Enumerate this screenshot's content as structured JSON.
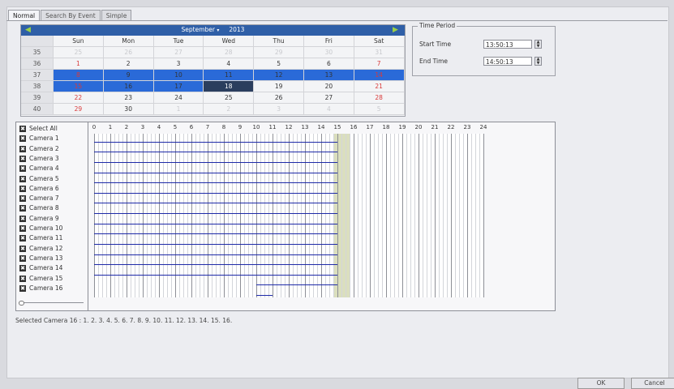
{
  "tabs": [
    "Normal",
    "Search By Event",
    "Simple"
  ],
  "calendar": {
    "month": "September",
    "year": "2013",
    "days": [
      "Sun",
      "Mon",
      "Tue",
      "Wed",
      "Thu",
      "Fri",
      "Sat"
    ],
    "weeks": [
      {
        "wk": "35",
        "cells": [
          "25",
          "26",
          "27",
          "28",
          "29",
          "30",
          "31"
        ]
      },
      {
        "wk": "36",
        "cells": [
          "1",
          "2",
          "3",
          "4",
          "5",
          "6",
          "7"
        ]
      },
      {
        "wk": "37",
        "cells": [
          "8",
          "9",
          "10",
          "11",
          "12",
          "13",
          "14"
        ]
      },
      {
        "wk": "38",
        "cells": [
          "15",
          "16",
          "17",
          "18",
          "19",
          "20",
          "21"
        ]
      },
      {
        "wk": "39",
        "cells": [
          "22",
          "23",
          "24",
          "25",
          "26",
          "27",
          "28"
        ]
      },
      {
        "wk": "40",
        "cells": [
          "29",
          "30",
          "1",
          "2",
          "3",
          "4",
          "5"
        ]
      }
    ]
  },
  "time_period": {
    "legend": "Time Period",
    "start_label": "Start Time",
    "start_value": "13:50:13",
    "end_label": "End Time",
    "end_value": "14:50:13"
  },
  "cameras": {
    "select_all": "Select All",
    "items": [
      "Camera 1",
      "Camera 2",
      "Camera 3",
      "Camera 4",
      "Camera 5",
      "Camera 6",
      "Camera 7",
      "Camera 8",
      "Camera 9",
      "Camera 10",
      "Camera 11",
      "Camera 12",
      "Camera 13",
      "Camera 14",
      "Camera 15",
      "Camera 16"
    ]
  },
  "hours": [
    "0",
    "1",
    "2",
    "3",
    "4",
    "5",
    "6",
    "7",
    "8",
    "9",
    "10",
    "11",
    "12",
    "13",
    "14",
    "15",
    "16",
    "17",
    "18",
    "19",
    "20",
    "21",
    "22",
    "23",
    "24"
  ],
  "recordings": [
    {
      "start": 0,
      "end": 15
    },
    {
      "start": 0,
      "end": 15
    },
    {
      "start": 0,
      "end": 15
    },
    {
      "start": 0,
      "end": 15
    },
    {
      "start": 0,
      "end": 15
    },
    {
      "start": 0,
      "end": 15
    },
    {
      "start": 0,
      "end": 15
    },
    {
      "start": 0,
      "end": 15
    },
    {
      "start": 0,
      "end": 15
    },
    {
      "start": 0,
      "end": 15
    },
    {
      "start": 0,
      "end": 15
    },
    {
      "start": 0,
      "end": 15
    },
    {
      "start": 0,
      "end": 15
    },
    {
      "start": 0,
      "end": 15
    },
    {
      "start": 10,
      "end": 15
    },
    {
      "start": 10,
      "end": 11
    }
  ],
  "selected_cameras": "Selected Camera 16 : 1. 2. 3. 4. 5. 6. 7. 8. 9. 10. 11. 12. 13. 14. 15. 16.",
  "buttons": {
    "ok": "OK",
    "cancel": "Cancel"
  },
  "colors": {
    "header": "#2f5fa7",
    "selected": "#2a6ad8",
    "current": "#2b3e5e",
    "recording": "#1e2aa8",
    "weekend": "#d93a3a"
  }
}
